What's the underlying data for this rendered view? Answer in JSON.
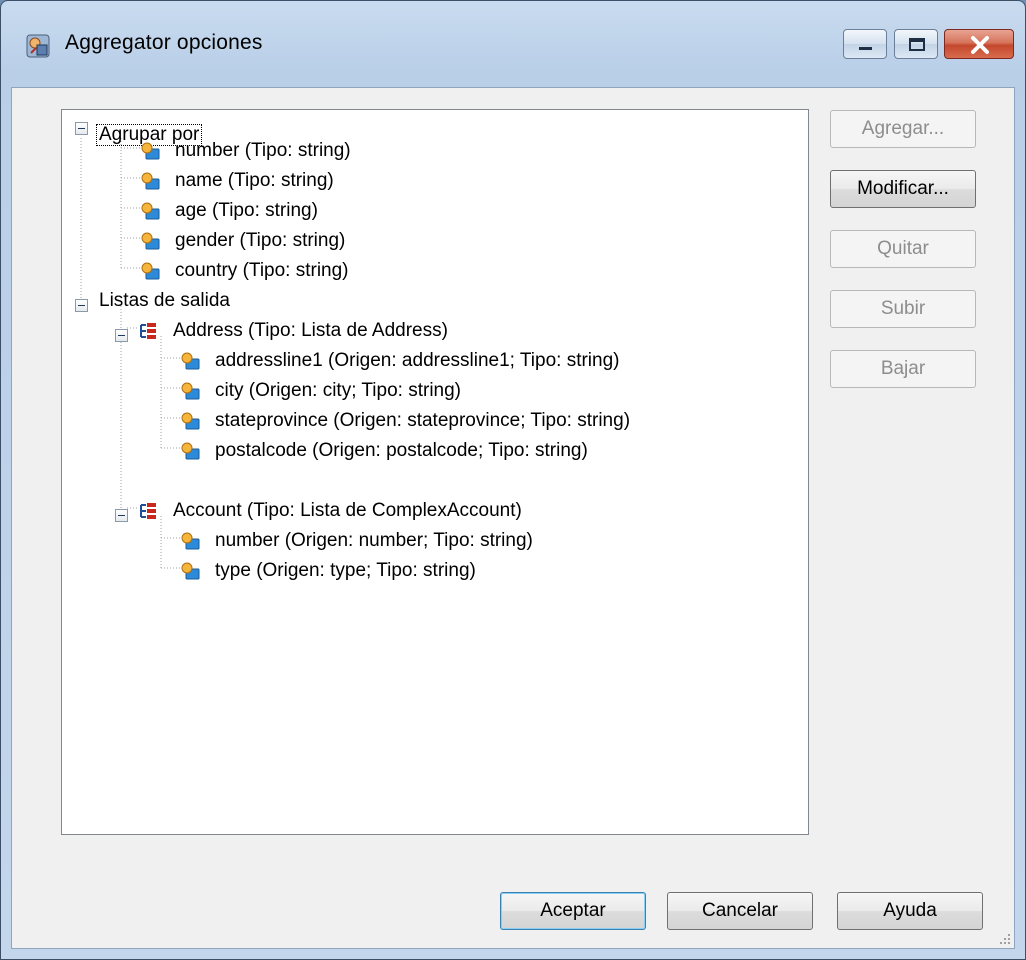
{
  "window": {
    "title": "Aggregator opciones",
    "controls": [
      "minimize-icon",
      "maximize-icon",
      "close-icon"
    ]
  },
  "tree": {
    "group_by": {
      "label": "Agrupar por",
      "expanded": true,
      "selected": true,
      "children": [
        "number (Tipo: string)",
        "name (Tipo: string)",
        "age (Tipo: string)",
        "gender (Tipo: string)",
        "country (Tipo: string)"
      ]
    },
    "output_lists": {
      "label": "Listas de salida",
      "expanded": true,
      "lists": [
        {
          "label": "Address (Tipo: Lista de Address)",
          "expanded": true,
          "children": [
            "addressline1 (Origen:  addressline1; Tipo: string)",
            "city (Origen: city; Tipo: string)",
            "stateprovince (Origen:  stateprovince; Tipo: string)",
            "postalcode (Origen: postalcode; Tipo: string)"
          ]
        },
        {
          "label": "Account (Tipo: Lista de ComplexAccount)",
          "expanded": true,
          "children": [
            "number (Origen:  number; Tipo: string)",
            "type (Origen: type; Tipo: string)"
          ]
        }
      ]
    }
  },
  "side_buttons": {
    "add": {
      "label": "Agregar...",
      "enabled": false
    },
    "modify": {
      "label": "Modificar...",
      "enabled": true
    },
    "remove": {
      "label": "Quitar",
      "enabled": false
    },
    "up": {
      "label": "Subir",
      "enabled": false
    },
    "down": {
      "label": "Bajar",
      "enabled": false
    }
  },
  "footer": {
    "ok": "Aceptar",
    "cancel": "Cancelar",
    "help": "Ayuda"
  },
  "icons": {
    "field": "field-icon",
    "list": "list-icon",
    "app": "app-icon"
  }
}
